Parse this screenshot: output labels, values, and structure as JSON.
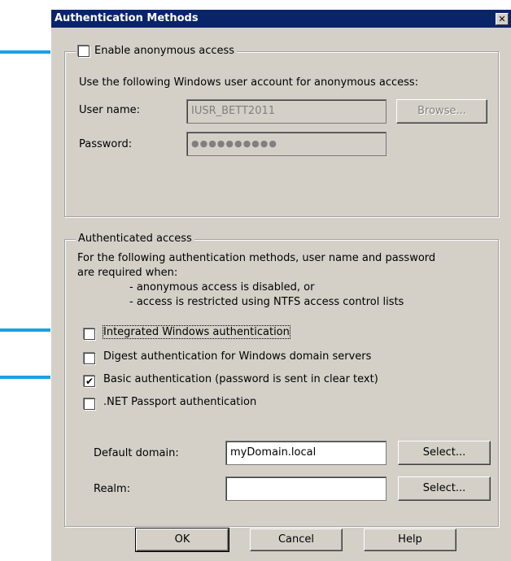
{
  "window": {
    "title": "Authentication Methods",
    "close_glyph": "✕"
  },
  "anonymous": {
    "checkbox_label": "Enable anonymous access",
    "checked": false,
    "description": "Use the following Windows user account for anonymous access:",
    "username_label": "User name:",
    "username_value": "IUSR_BETT2011",
    "password_label": "Password:",
    "password_value": "●●●●●●●●●●",
    "browse_label": "Browse..."
  },
  "authenticated": {
    "group_label": "Authenticated access",
    "description_line1": "For the following authentication methods, user name and password",
    "description_line2": "are required when:",
    "bullet1": "- anonymous access is disabled, or",
    "bullet2": "- access is restricted using NTFS access control lists",
    "options": [
      {
        "label": "Integrated Windows authentication",
        "checked": false
      },
      {
        "label": "Digest authentication for Windows domain servers",
        "checked": false
      },
      {
        "label": "Basic authentication (password is sent in clear text)",
        "checked": true
      },
      {
        "label": ".NET Passport authentication",
        "checked": false
      }
    ],
    "default_domain_label": "Default domain:",
    "default_domain_value": "myDomain.local",
    "realm_label": "Realm:",
    "realm_value": "",
    "select_label": "Select..."
  },
  "buttons": {
    "ok": "OK",
    "cancel": "Cancel",
    "help": "Help"
  },
  "colors": {
    "title_bar": "#0a246a",
    "face": "#d4d0c8",
    "annotation_arrow": "#1ba1e2"
  }
}
